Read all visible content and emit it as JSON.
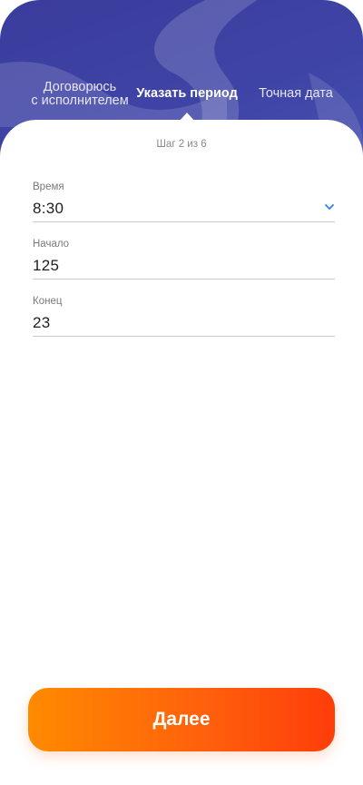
{
  "tabs": [
    {
      "label_line1": "Договорюсь",
      "label_line2": "с исполнителем"
    },
    {
      "label": "Указать период"
    },
    {
      "label": "Точная дата"
    }
  ],
  "step": "Шаг 2 из 6",
  "fields": {
    "time": {
      "label": "Время",
      "value": "8:30"
    },
    "start": {
      "label": "Начало",
      "value": "125"
    },
    "end": {
      "label": "Конец",
      "value": "23"
    }
  },
  "next_button": {
    "label": "Далее"
  },
  "icons": {
    "dropdown": "chevron-down-icon"
  },
  "colors": {
    "header": "#3e44a6",
    "accent_blue": "#2f80ed",
    "button_start": "#ff8a00",
    "button_end": "#ff3d0a"
  }
}
